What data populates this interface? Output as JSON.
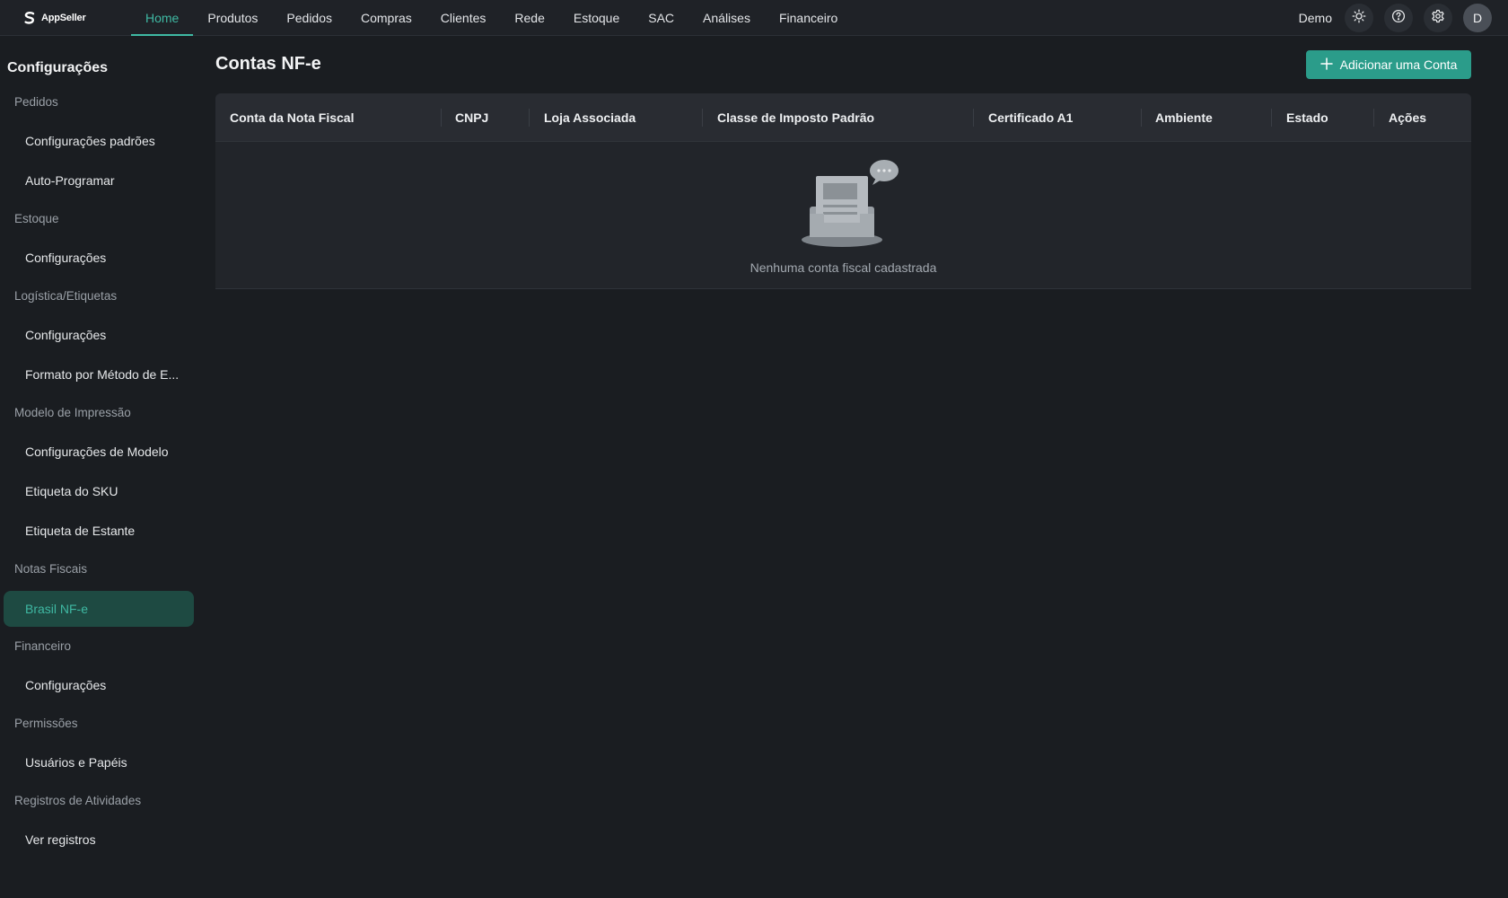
{
  "app": {
    "logo_text": "AppSeller"
  },
  "nav": {
    "items": [
      {
        "label": "Home",
        "active": true
      },
      {
        "label": "Produtos"
      },
      {
        "label": "Pedidos"
      },
      {
        "label": "Compras"
      },
      {
        "label": "Clientes"
      },
      {
        "label": "Rede"
      },
      {
        "label": "Estoque"
      },
      {
        "label": "SAC"
      },
      {
        "label": "Análises"
      },
      {
        "label": "Financeiro"
      }
    ]
  },
  "user": {
    "name": "Demo",
    "avatar_initial": "D"
  },
  "icons": {
    "theme": "sun-icon",
    "help": "help-circle-icon",
    "settings": "gear-icon",
    "add": "plus-icon",
    "empty": "empty-inbox-icon"
  },
  "sidebar": {
    "title": "Configurações",
    "groups": [
      {
        "label": "Pedidos",
        "items": [
          "Configurações padrões",
          "Auto-Programar"
        ]
      },
      {
        "label": "Estoque",
        "items": [
          "Configurações"
        ]
      },
      {
        "label": "Logística/Etiquetas",
        "items": [
          "Configurações",
          "Formato por Método de E..."
        ]
      },
      {
        "label": "Modelo de Impressão",
        "items": [
          "Configurações de Modelo",
          "Etiqueta do SKU",
          "Etiqueta de Estante"
        ]
      },
      {
        "label": "Notas Fiscais",
        "items": [
          "Brasil NF-e"
        ]
      },
      {
        "label": "Financeiro",
        "items": [
          "Configurações"
        ]
      },
      {
        "label": "Permissões",
        "items": [
          "Usuários e Papéis"
        ]
      },
      {
        "label": "Registros de Atividades",
        "items": [
          "Ver registros"
        ]
      }
    ],
    "active_item": "Brasil NF-e"
  },
  "main": {
    "title": "Contas NF-e",
    "add_button_label": "Adicionar uma Conta",
    "table": {
      "columns": [
        "Conta da Nota Fiscal",
        "CNPJ",
        "Loja Associada",
        "Classe de Imposto Padrão",
        "Certificado A1",
        "Ambiente",
        "Estado",
        "Ações"
      ],
      "rows": [],
      "empty_text": "Nenhuma conta fiscal cadastrada"
    }
  },
  "colors": {
    "accent": "#3fb9a3",
    "button": "#2b9c8a",
    "background": "#1a1d21",
    "active_sidebar_bg": "#1e4a42"
  }
}
